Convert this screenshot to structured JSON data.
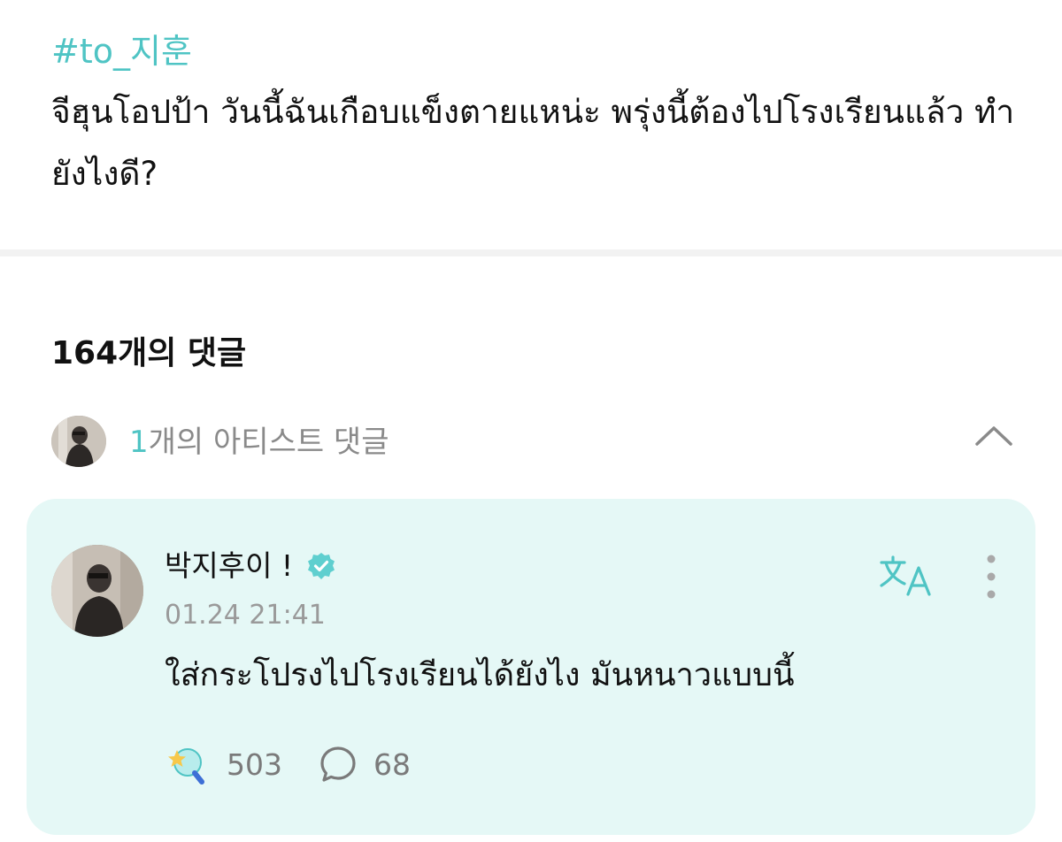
{
  "post": {
    "hashtag": "#to_지훈",
    "body": "จีฮุนโอปป้า วันนี้ฉันเกือบแข็งตายแหน่ะ พรุ่งนี้ต้องไปโรงเรียนแล้ว ทำยังไงดี?"
  },
  "comments": {
    "count_label": "164개의 댓글",
    "artist_section": {
      "count": "1",
      "label": "개의 아티스트 댓글",
      "collapse_icon": "chevron-up-icon"
    }
  },
  "artist_comment": {
    "author": "박지후이 !",
    "verified_icon": "verified-badge-icon",
    "timestamp": "01.24 21:41",
    "text": "ใส่กระโปรงไปโรงเรียนได้ยังไง มันหนาวแบบนี้",
    "translate_icon": "translate-icon",
    "more_icon": "more-vertical-icon",
    "likes": "503",
    "replies": "68"
  },
  "colors": {
    "accent": "#4fc4c4",
    "card_background": "#e5f8f6",
    "muted_text": "#8a8a8a"
  }
}
